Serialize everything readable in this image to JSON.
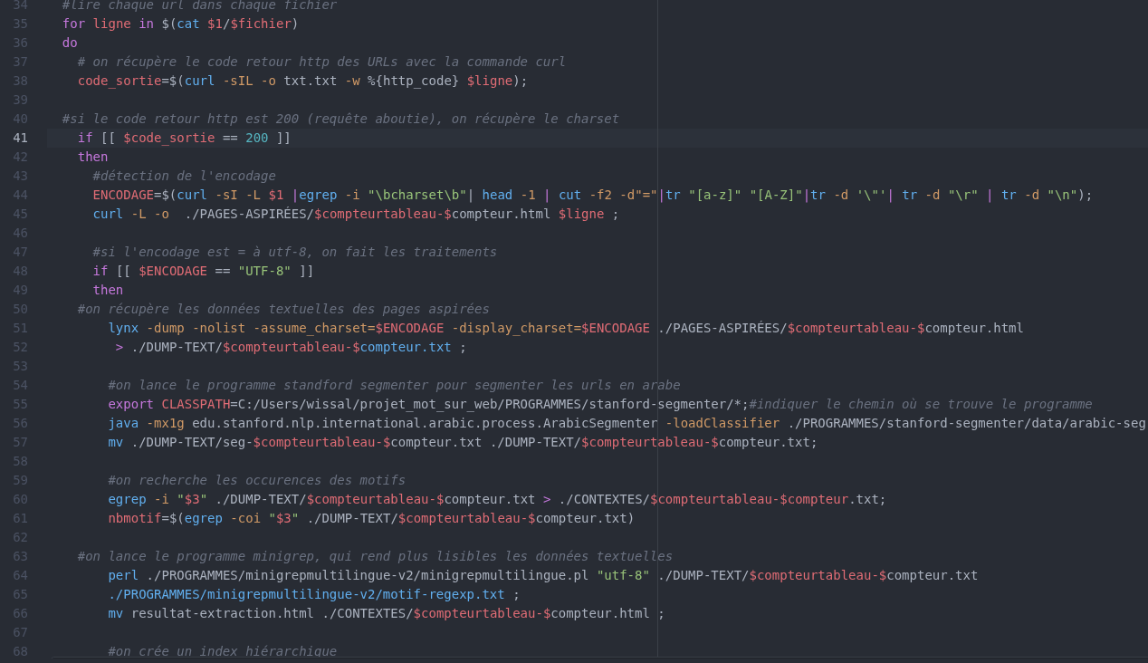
{
  "editor": {
    "lines": [
      {
        "number": "34",
        "current": false,
        "tokens": [
          {
            "text": "  #lire chaque url dans chaque fichier",
            "kind": "comment"
          }
        ]
      },
      {
        "number": "35",
        "current": false,
        "tokens": [
          {
            "text": "  for",
            "kind": "keyword"
          },
          {
            "text": " ligne",
            "kind": "variable"
          },
          {
            "text": " in",
            "kind": "keyword"
          },
          {
            "text": " $(",
            "kind": "plain"
          },
          {
            "text": "cat",
            "kind": "command"
          },
          {
            "text": " $1",
            "kind": "variable"
          },
          {
            "text": "/",
            "kind": "plain"
          },
          {
            "text": "$fichier",
            "kind": "variable"
          },
          {
            "text": ")",
            "kind": "plain"
          }
        ]
      },
      {
        "number": "36",
        "current": false,
        "tokens": [
          {
            "text": "  do",
            "kind": "keyword"
          }
        ]
      },
      {
        "number": "37",
        "current": false,
        "tokens": [
          {
            "text": "    # on récupère le code retour http des URLs avec la commande curl",
            "kind": "comment"
          }
        ]
      },
      {
        "number": "38",
        "current": false,
        "tokens": [
          {
            "text": "    code_sortie",
            "kind": "variable"
          },
          {
            "text": "=$(",
            "kind": "plain"
          },
          {
            "text": "curl",
            "kind": "command"
          },
          {
            "text": " -sIL -o",
            "kind": "option"
          },
          {
            "text": " txt.txt",
            "kind": "plain"
          },
          {
            "text": " -w",
            "kind": "option"
          },
          {
            "text": " %{http_code}",
            "kind": "plain"
          },
          {
            "text": " $ligne",
            "kind": "variable"
          },
          {
            "text": ");",
            "kind": "plain"
          }
        ]
      },
      {
        "number": "39",
        "current": false
      },
      {
        "number": "40",
        "current": false,
        "tokens": [
          {
            "text": "  #si le code retour http est 200 (requête aboutie), on récupère le charset",
            "kind": "comment"
          }
        ]
      },
      {
        "number": "41",
        "current": true,
        "tokens": [
          {
            "text": "    if",
            "kind": "keyword"
          },
          {
            "text": " [[",
            "kind": "plain"
          },
          {
            "text": " $code_sortie",
            "kind": "variable"
          },
          {
            "text": " ==",
            "kind": "plain"
          },
          {
            "text": " 200",
            "kind": "number"
          },
          {
            "text": " ]]",
            "kind": "plain"
          }
        ]
      },
      {
        "number": "42",
        "current": false,
        "tokens": [
          {
            "text": "    then",
            "kind": "keyword"
          }
        ]
      },
      {
        "number": "43",
        "current": false,
        "tokens": [
          {
            "text": "      #détection de l'encodage",
            "kind": "comment"
          }
        ]
      },
      {
        "number": "44",
        "current": false,
        "tokens": [
          {
            "text": "      ENCODAGE",
            "kind": "variable"
          },
          {
            "text": "=$(",
            "kind": "plain"
          },
          {
            "text": "curl",
            "kind": "command"
          },
          {
            "text": " -sI -L",
            "kind": "option"
          },
          {
            "text": " $1",
            "kind": "variable"
          },
          {
            "text": " |",
            "kind": "keyword"
          },
          {
            "text": "egrep",
            "kind": "command"
          },
          {
            "text": " -i",
            "kind": "option"
          },
          {
            "text": " \"\\bcharset\\b\"",
            "kind": "string"
          },
          {
            "text": "|",
            "kind": "plain"
          },
          {
            "text": " head",
            "kind": "command"
          },
          {
            "text": " -1",
            "kind": "option"
          },
          {
            "text": " |",
            "kind": "keyword"
          },
          {
            "text": " cut",
            "kind": "command"
          },
          {
            "text": " -f2 -d\"=\"",
            "kind": "option"
          },
          {
            "text": "|",
            "kind": "keyword"
          },
          {
            "text": "tr",
            "kind": "command"
          },
          {
            "text": " \"[a-z]\" \"[A-Z]\"",
            "kind": "string"
          },
          {
            "text": "|",
            "kind": "keyword"
          },
          {
            "text": "tr",
            "kind": "command"
          },
          {
            "text": " -d",
            "kind": "option"
          },
          {
            "text": " '\\\"'",
            "kind": "string"
          },
          {
            "text": "|",
            "kind": "keyword"
          },
          {
            "text": " tr",
            "kind": "command"
          },
          {
            "text": " -d",
            "kind": "option"
          },
          {
            "text": " \"\\r\"",
            "kind": "string"
          },
          {
            "text": " |",
            "kind": "keyword"
          },
          {
            "text": " tr",
            "kind": "command"
          },
          {
            "text": " -d",
            "kind": "option"
          },
          {
            "text": " \"\\n\"",
            "kind": "string"
          },
          {
            "text": ");",
            "kind": "plain"
          }
        ]
      },
      {
        "number": "45",
        "current": false,
        "tokens": [
          {
            "text": "      curl",
            "kind": "command"
          },
          {
            "text": " -L -o",
            "kind": "option"
          },
          {
            "text": "  ./PAGES-ASPIRÉES/",
            "kind": "plain"
          },
          {
            "text": "$compteurtableau-$",
            "kind": "variable"
          },
          {
            "text": "compteur.html",
            "kind": "plain"
          },
          {
            "text": " $ligne",
            "kind": "variable"
          },
          {
            "text": " ;",
            "kind": "plain"
          }
        ]
      },
      {
        "number": "46",
        "current": false
      },
      {
        "number": "47",
        "current": false,
        "tokens": [
          {
            "text": "      #si l'encodage est = à utf-8, on fait les traitements",
            "kind": "comment"
          }
        ]
      },
      {
        "number": "48",
        "current": false,
        "tokens": [
          {
            "text": "      if",
            "kind": "keyword"
          },
          {
            "text": " [[",
            "kind": "plain"
          },
          {
            "text": " $ENCODAGE",
            "kind": "variable"
          },
          {
            "text": " ==",
            "kind": "plain"
          },
          {
            "text": " \"UTF-8\"",
            "kind": "string"
          },
          {
            "text": " ]]",
            "kind": "plain"
          }
        ]
      },
      {
        "number": "49",
        "current": false,
        "tokens": [
          {
            "text": "      then",
            "kind": "keyword"
          }
        ]
      },
      {
        "number": "50",
        "current": false,
        "tokens": [
          {
            "text": "    #on récupère les données textuelles des pages aspirées",
            "kind": "comment"
          }
        ]
      },
      {
        "number": "51",
        "current": false,
        "tokens": [
          {
            "text": "        lynx",
            "kind": "command"
          },
          {
            "text": " -dump -nolist -assume_charset=",
            "kind": "option"
          },
          {
            "text": "$ENCODAGE",
            "kind": "variable"
          },
          {
            "text": " -display_charset=",
            "kind": "option"
          },
          {
            "text": "$ENCODAGE",
            "kind": "variable"
          },
          {
            "text": " ./PAGES-ASPIRÉES/",
            "kind": "plain"
          },
          {
            "text": "$compteurtableau-$",
            "kind": "variable"
          },
          {
            "text": "compteur.html",
            "kind": "plain"
          }
        ]
      },
      {
        "number": "52",
        "current": false,
        "tokens": [
          {
            "text": "         >",
            "kind": "keyword"
          },
          {
            "text": " ./DUMP-TEXT/",
            "kind": "plain"
          },
          {
            "text": "$compteurtableau-$",
            "kind": "variable"
          },
          {
            "text": "compteur.txt",
            "kind": "command"
          },
          {
            "text": " ;",
            "kind": "plain"
          }
        ]
      },
      {
        "number": "53",
        "current": false
      },
      {
        "number": "54",
        "current": false,
        "tokens": [
          {
            "text": "        #on lance le programme standford segmenter pour segmenter les urls en arabe",
            "kind": "comment"
          }
        ]
      },
      {
        "number": "55",
        "current": false,
        "tokens": [
          {
            "text": "        export",
            "kind": "keyword"
          },
          {
            "text": " CLASSPATH",
            "kind": "variable"
          },
          {
            "text": "=C:/Users/wissal/projet_mot_sur_web/PROGRAMMES/stanford-segmenter/*;",
            "kind": "plain"
          },
          {
            "text": "#indiquer le chemin où se trouve le programme",
            "kind": "comment"
          }
        ]
      },
      {
        "number": "56",
        "current": false,
        "tokens": [
          {
            "text": "        java",
            "kind": "command"
          },
          {
            "text": " -mx1g",
            "kind": "option"
          },
          {
            "text": " edu.stanford.nlp.international.arabic.process.ArabicSegmenter",
            "kind": "plain"
          },
          {
            "text": " -loadClassifier",
            "kind": "option"
          },
          {
            "text": " ./PROGRAMMES/stanford-segmenter/data/arabic-seg",
            "kind": "plain"
          }
        ]
      },
      {
        "number": "57",
        "current": false,
        "tokens": [
          {
            "text": "        mv",
            "kind": "command"
          },
          {
            "text": " ./DUMP-TEXT/seg-",
            "kind": "plain"
          },
          {
            "text": "$compteurtableau-$",
            "kind": "variable"
          },
          {
            "text": "compteur.txt ./DUMP-TEXT/",
            "kind": "plain"
          },
          {
            "text": "$compteurtableau-$",
            "kind": "variable"
          },
          {
            "text": "compteur.txt;",
            "kind": "plain"
          }
        ]
      },
      {
        "number": "58",
        "current": false
      },
      {
        "number": "59",
        "current": false,
        "tokens": [
          {
            "text": "        #on recherche les occurences des motifs",
            "kind": "comment"
          }
        ]
      },
      {
        "number": "60",
        "current": false,
        "tokens": [
          {
            "text": "        egrep",
            "kind": "command"
          },
          {
            "text": " -i",
            "kind": "option"
          },
          {
            "text": " \"",
            "kind": "string"
          },
          {
            "text": "$3",
            "kind": "variable"
          },
          {
            "text": "\"",
            "kind": "string"
          },
          {
            "text": " ./DUMP-TEXT/",
            "kind": "plain"
          },
          {
            "text": "$compteurtableau-$",
            "kind": "variable"
          },
          {
            "text": "compteur.txt",
            "kind": "plain"
          },
          {
            "text": " >",
            "kind": "keyword"
          },
          {
            "text": " ./CONTEXTES/",
            "kind": "plain"
          },
          {
            "text": "$compteurtableau-$compteur",
            "kind": "variable"
          },
          {
            "text": ".txt;",
            "kind": "plain"
          }
        ]
      },
      {
        "number": "61",
        "current": false,
        "tokens": [
          {
            "text": "        nbmotif",
            "kind": "variable"
          },
          {
            "text": "=$(",
            "kind": "plain"
          },
          {
            "text": "egrep",
            "kind": "command"
          },
          {
            "text": " -coi",
            "kind": "option"
          },
          {
            "text": " \"",
            "kind": "string"
          },
          {
            "text": "$3",
            "kind": "variable"
          },
          {
            "text": "\"",
            "kind": "string"
          },
          {
            "text": " ./DUMP-TEXT/",
            "kind": "plain"
          },
          {
            "text": "$compteurtableau-$",
            "kind": "variable"
          },
          {
            "text": "compteur.txt)",
            "kind": "plain"
          }
        ]
      },
      {
        "number": "62",
        "current": false
      },
      {
        "number": "63",
        "current": false,
        "tokens": [
          {
            "text": "    #on lance le programme minigrep, qui rend plus lisibles les données textuelles",
            "kind": "comment"
          }
        ]
      },
      {
        "number": "64",
        "current": false,
        "tokens": [
          {
            "text": "        perl",
            "kind": "command"
          },
          {
            "text": " ./PROGRAMMES/minigrepmultilingue-v2/minigrepmultilingue.pl",
            "kind": "plain"
          },
          {
            "text": " \"utf-8\"",
            "kind": "string"
          },
          {
            "text": " ./DUMP-TEXT/",
            "kind": "plain"
          },
          {
            "text": "$compteurtableau-$",
            "kind": "variable"
          },
          {
            "text": "compteur.txt",
            "kind": "plain"
          }
        ]
      },
      {
        "number": "65",
        "current": false,
        "tokens": [
          {
            "text": "        ./PROGRAMMES/minigrepmultilingue-v2/motif-regexp.txt",
            "kind": "command"
          },
          {
            "text": " ;",
            "kind": "plain"
          }
        ]
      },
      {
        "number": "66",
        "current": false,
        "tokens": [
          {
            "text": "        mv",
            "kind": "command"
          },
          {
            "text": " resultat-extraction.html ./CONTEXTES/",
            "kind": "plain"
          },
          {
            "text": "$compteurtableau-$",
            "kind": "variable"
          },
          {
            "text": "compteur.html ;",
            "kind": "plain"
          }
        ]
      },
      {
        "number": "67",
        "current": false
      },
      {
        "number": "68",
        "current": false,
        "tokens": [
          {
            "text": "        #on crée un index hiérarchique",
            "kind": "comment"
          }
        ]
      }
    ]
  }
}
